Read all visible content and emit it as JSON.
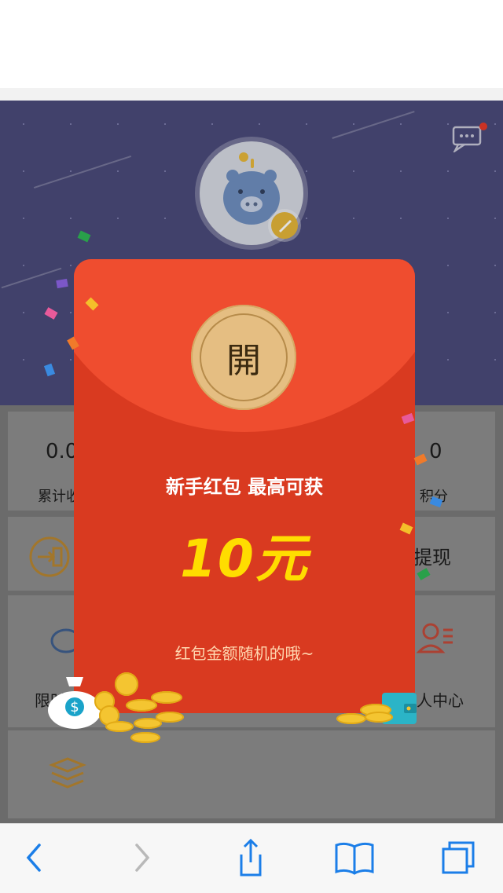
{
  "header": {
    "title": "",
    "messages_icon": "chat-dots-icon"
  },
  "stats": [
    {
      "value": "0.0",
      "label": "累计收"
    },
    {
      "value": "0",
      "label": "积分"
    }
  ],
  "menu": {
    "left_label": "限时",
    "right_label": "提现",
    "profile_label": "人中心"
  },
  "red_packet": {
    "open_text": "開",
    "headline": "新手红包  最高可获",
    "amount": "10元",
    "note": "红包金额随机的哦~"
  },
  "toolbar": {
    "back_icon": "chevron-left-icon",
    "forward_icon": "chevron-right-icon",
    "share_icon": "share-icon",
    "bookmarks_icon": "book-icon",
    "tabs_icon": "tabs-icon"
  },
  "colors": {
    "hero_bg": "#4a4a7a",
    "packet_red": "#d93a20",
    "packet_flap": "#ef4d2f",
    "gold": "#e5be82",
    "amount_yellow": "#ffdd00"
  }
}
